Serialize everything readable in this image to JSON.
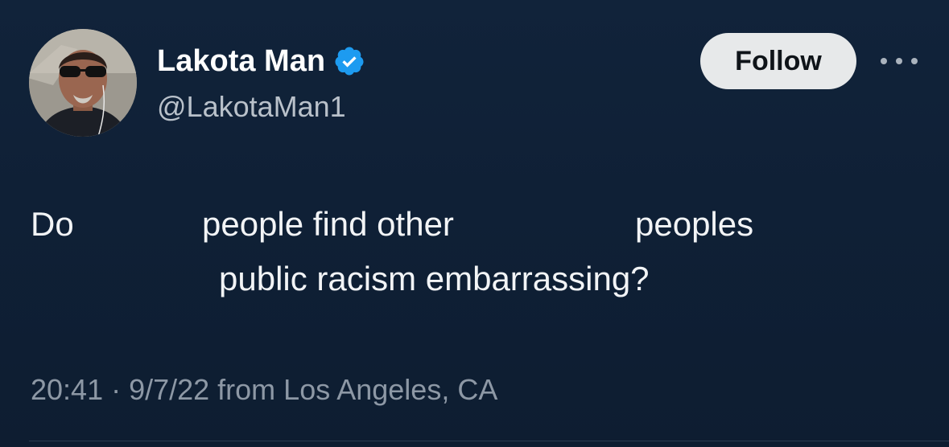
{
  "user": {
    "display_name": "Lakota Man",
    "handle": "@LakotaMan1",
    "verified": true
  },
  "actions": {
    "follow_label": "Follow",
    "more_icon": "more-horizontal-icon"
  },
  "tweet": {
    "word_1": "Do",
    "word_2": "people find other",
    "word_3": "peoples",
    "line_2": "public racism embarrassing?"
  },
  "meta": {
    "timestamp": "20:41 · 9/7/22 from Los Angeles, CA"
  },
  "colors": {
    "background": "#0f2036",
    "verified_badge": "#1d9bf0",
    "follow_button_bg": "#e7e9ea"
  }
}
